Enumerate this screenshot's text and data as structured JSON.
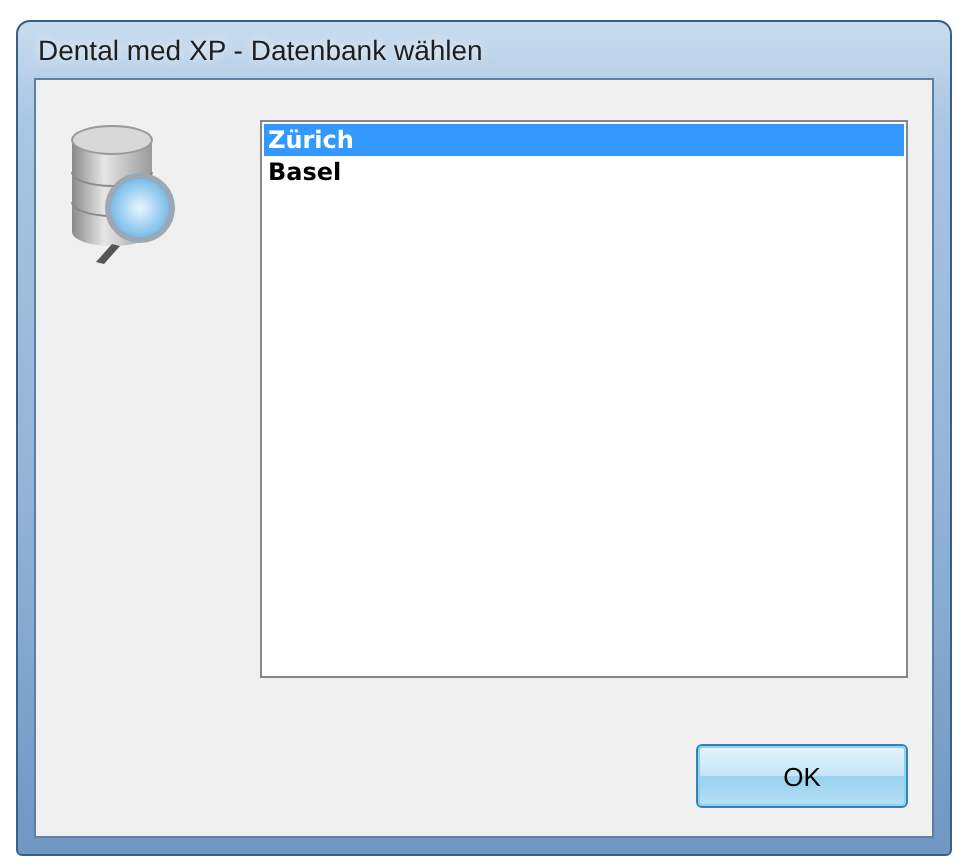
{
  "window": {
    "title": "Dental med XP - Datenbank wählen"
  },
  "databases": [
    {
      "label": "Zürich",
      "selected": true
    },
    {
      "label": "Basel",
      "selected": false
    }
  ],
  "buttons": [
    {
      "label": "OK"
    }
  ]
}
